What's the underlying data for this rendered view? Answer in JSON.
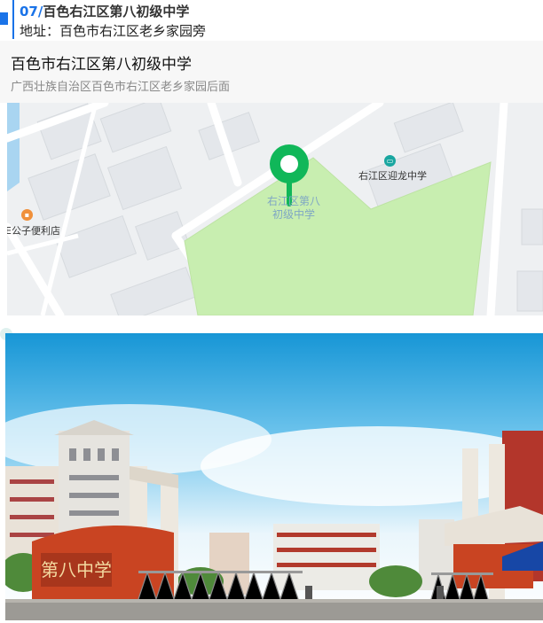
{
  "header": {
    "number": "07/",
    "title": "百色右江区第八初级中学",
    "address": "地址：百色市右江区老乡家园旁"
  },
  "card": {
    "name": "百色市右江区第八初级中学",
    "address": "广西壮族自治区百色市右江区老乡家园后面"
  },
  "map": {
    "school_label_line1": "右江区第八",
    "school_label_line2": "初级中学",
    "poi_yinglong": "右江区迎龙中学",
    "poi_store": "E公子便利店",
    "pin_icon": "location-pin-icon",
    "school_icon": "school-icon",
    "store_icon": "shop-icon",
    "colors": {
      "campus": "#c8eeb0",
      "pin": "#10b759",
      "road": "#ffffff",
      "block": "#e3e6ea"
    }
  },
  "photo": {
    "gate_sign": "第八中学",
    "sky_top": "#1796d6",
    "sky_bottom": "#ffffff"
  }
}
